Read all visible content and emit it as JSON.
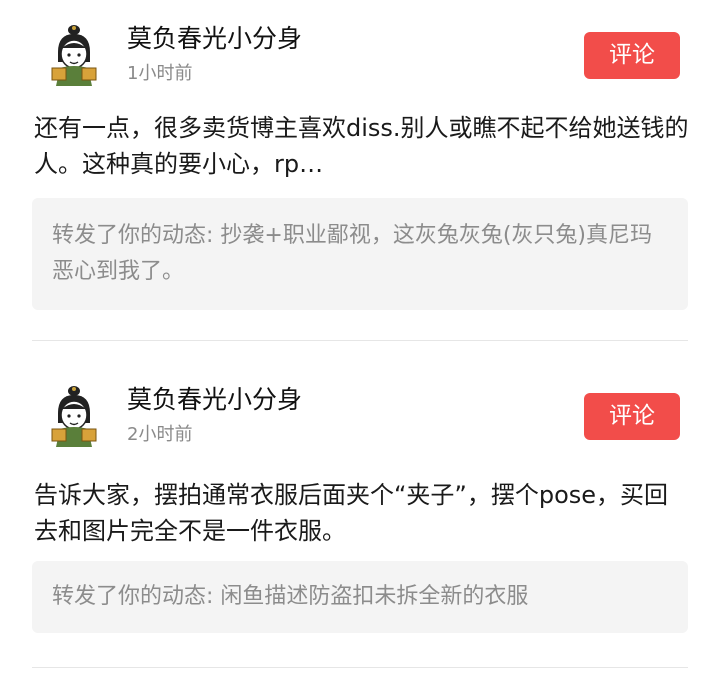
{
  "posts": [
    {
      "username": "莫负春光小分身",
      "time": "1小时前",
      "comment_label": "评论",
      "content": "还有一点，很多卖货博主喜欢diss.别人或瞧不起不给她送钱的人。这种真的要小心，rp…",
      "quote": "转发了你的动态: 抄袭+职业鄙视，这灰兔灰兔(灰只兔)真尼玛恶心到我了。"
    },
    {
      "username": "莫负春光小分身",
      "time": "2小时前",
      "comment_label": "评论",
      "content": "告诉大家，摆拍通常衣服后面夹个“夹子”，摆个pose，买回去和图片完全不是一件衣服。",
      "quote": "转发了你的动态: 闲鱼描述防盗扣未拆全新的衣服"
    }
  ],
  "colors": {
    "accent": "#f24d4a",
    "quote_bg": "#f4f4f4",
    "meta_text": "#8a8a8a"
  },
  "icons": {
    "avatar": "cartoon-girl-avatar-icon"
  }
}
